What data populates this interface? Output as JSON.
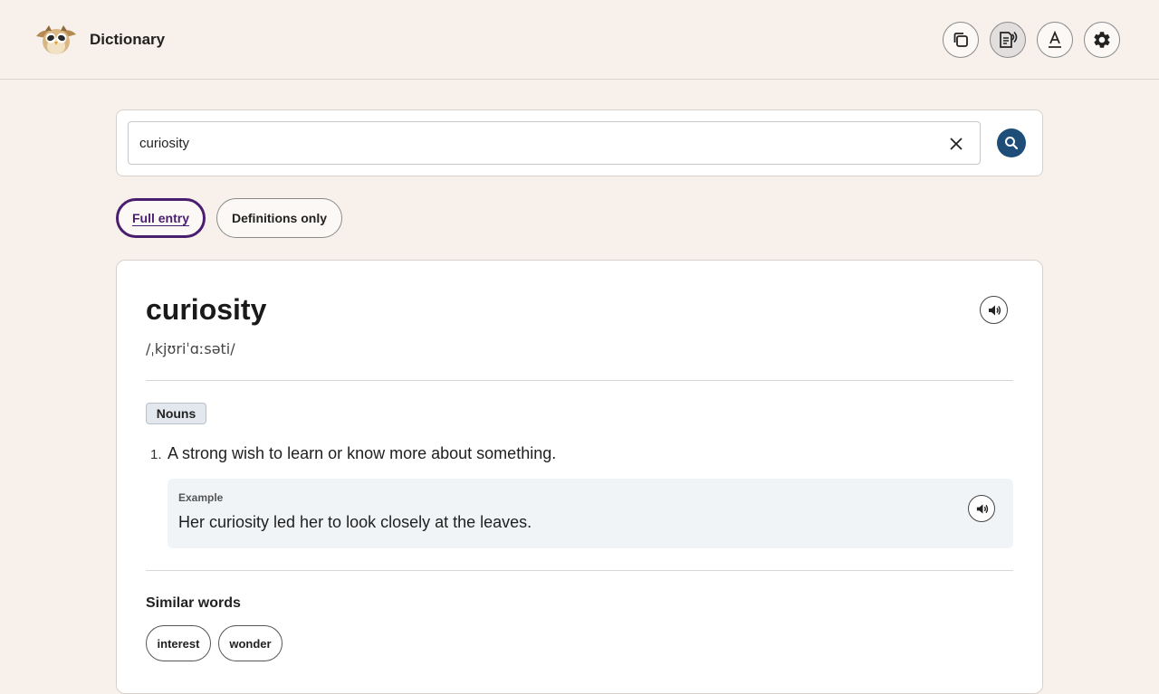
{
  "header": {
    "title": "Dictionary",
    "logo": "owl-logo",
    "tools": [
      {
        "name": "copy-icon"
      },
      {
        "name": "read-aloud-icon"
      },
      {
        "name": "text-style-icon"
      },
      {
        "name": "settings-gear-icon"
      }
    ]
  },
  "search": {
    "value": "curiosity",
    "placeholder": "",
    "clear_icon": "close-icon",
    "submit_icon": "search-icon"
  },
  "modes": {
    "full_entry": "Full entry",
    "definitions_only": "Definitions only",
    "selected": "Full entry"
  },
  "entry": {
    "word": "curiosity",
    "pronunciation": "/ˌkjʊriˈɑːsəti/",
    "part_of_speech": "Nouns",
    "definitions": [
      {
        "number": "1.",
        "text": "A strong wish to learn or know more about something.",
        "example_label": "Example",
        "example": "Her curiosity led her to look closely at the leaves."
      }
    ],
    "similar_title": "Similar words",
    "similar_words": [
      "interest",
      "wonder"
    ]
  },
  "colors": {
    "background": "#f8f1eb",
    "accent_purple": "#4a1e6e",
    "search_button": "#1e4d78",
    "badge_bg": "#e3e8ef",
    "example_bg": "#f1f4f7"
  }
}
